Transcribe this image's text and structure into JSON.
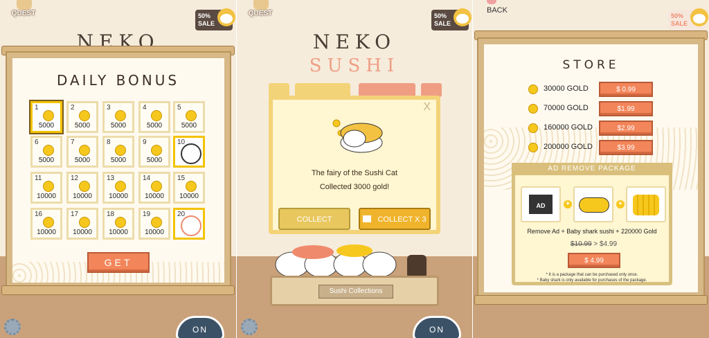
{
  "colors": {
    "accent_orange": "#f3855a",
    "coin_gold": "#f6c81e",
    "frame_wood": "#d7b987",
    "popup_yellow": "#f3d378"
  },
  "panel1": {
    "quest_label": "QUEST",
    "sale_label": "50%\nSALE",
    "logo_partial": "NEKO",
    "title": "DAILY BONUS",
    "days": [
      {
        "day": "1",
        "amount": "5000",
        "state": "today"
      },
      {
        "day": "2",
        "amount": "5000"
      },
      {
        "day": "3",
        "amount": "5000"
      },
      {
        "day": "4",
        "amount": "5000"
      },
      {
        "day": "5",
        "amount": "5000"
      },
      {
        "day": "6",
        "amount": "5000"
      },
      {
        "day": "7",
        "amount": "5000"
      },
      {
        "day": "8",
        "amount": "5000"
      },
      {
        "day": "9",
        "amount": "5000"
      },
      {
        "day": "10",
        "amount": "",
        "state": "special",
        "reward_icon": "black-cat-sushi-icon"
      },
      {
        "day": "11",
        "amount": "10000"
      },
      {
        "day": "12",
        "amount": "10000"
      },
      {
        "day": "13",
        "amount": "10000"
      },
      {
        "day": "14",
        "amount": "10000"
      },
      {
        "day": "15",
        "amount": "10000"
      },
      {
        "day": "16",
        "amount": "10000"
      },
      {
        "day": "17",
        "amount": "10000"
      },
      {
        "day": "18",
        "amount": "10000"
      },
      {
        "day": "19",
        "amount": "10000"
      },
      {
        "day": "20",
        "amount": "",
        "state": "special",
        "reward_icon": "salmon-cat-sushi-icon"
      }
    ],
    "get_label": "GET",
    "bowl_label": "ON"
  },
  "panel2": {
    "quest_label": "QUEST",
    "sale_label": "50%\nSALE",
    "logo_line1": "NEKO",
    "logo_line2": "SUSHI",
    "popup": {
      "close_label": "X",
      "message_line1": "The fairy of the Sushi Cat",
      "message_line2": "Collected 3000 gold!",
      "collect_label": "COLLECT",
      "collect_x3_label": "COLLECT X 3"
    },
    "board_label": "Sushi Collections",
    "bowl_label": "ON"
  },
  "panel3": {
    "back_label": "BACK",
    "sale_label": "50%\nSALE",
    "title": "STORE",
    "items": [
      {
        "gold": "30000 GOLD",
        "price": "$ 0.99"
      },
      {
        "gold": "70000 GOLD",
        "price": "$1.99"
      },
      {
        "gold": "160000 GOLD",
        "price": "$2.99"
      },
      {
        "gold": "200000 GOLD",
        "price": "$3.99"
      }
    ],
    "package": {
      "header": "AD REMOVE PACKAGE",
      "ad_icon_label": "AD",
      "description": "Remove Ad + Baby shark sushi + 220000 Gold",
      "old_price": "$10.99",
      "arrow": ">",
      "new_price": "$4.99",
      "buy_label": "$ 4.99",
      "note_line1": "* It is a package that can be purchased only once.",
      "note_line2": "* Baby shark is only available for purchases of the package."
    }
  }
}
